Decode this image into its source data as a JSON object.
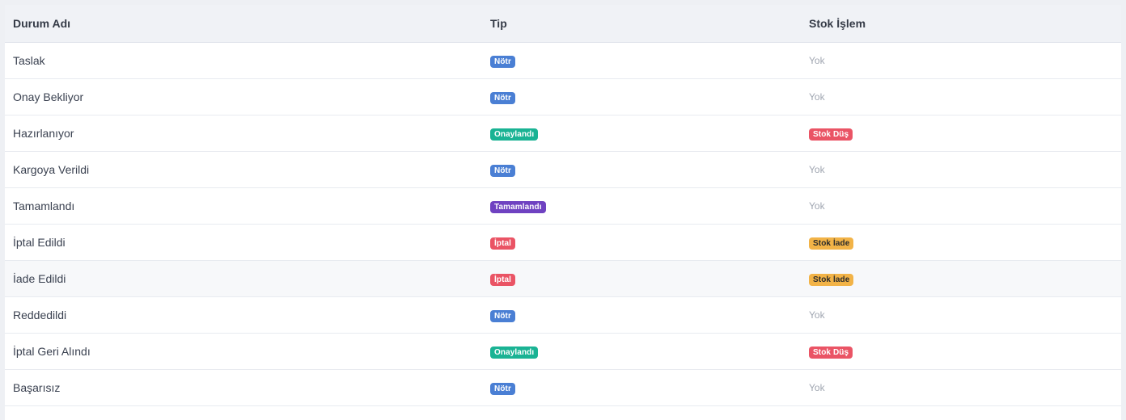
{
  "table": {
    "headers": [
      "Durum Adı",
      "Tip",
      "Stok İşlem"
    ],
    "rows": [
      {
        "name": "Taslak",
        "type": {
          "label": "Nötr",
          "color": "#4a7fd4"
        },
        "stock": {
          "label": "Yok",
          "badge": false
        }
      },
      {
        "name": "Onay Bekliyor",
        "type": {
          "label": "Nötr",
          "color": "#4a7fd4"
        },
        "stock": {
          "label": "Yok",
          "badge": false
        }
      },
      {
        "name": "Hazırlanıyor",
        "type": {
          "label": "Onaylandı",
          "color": "#1ab394"
        },
        "stock": {
          "label": "Stok Düş",
          "badge": true,
          "color": "#ea5465",
          "text_color": "#ffffff"
        }
      },
      {
        "name": "Kargoya Verildi",
        "type": {
          "label": "Nötr",
          "color": "#4a7fd4"
        },
        "stock": {
          "label": "Yok",
          "badge": false
        }
      },
      {
        "name": "Tamamlandı",
        "type": {
          "label": "Tamamlandı",
          "color": "#6f42c1"
        },
        "stock": {
          "label": "Yok",
          "badge": false
        }
      },
      {
        "name": "İptal Edildi",
        "type": {
          "label": "İptal",
          "color": "#ea5465"
        },
        "stock": {
          "label": "Stok İade",
          "badge": true,
          "color": "#f2b347",
          "text_color": "#2b2b2b"
        }
      },
      {
        "name": "İade Edildi",
        "type": {
          "label": "İptal",
          "color": "#ea5465"
        },
        "stock": {
          "label": "Stok İade",
          "badge": true,
          "color": "#f2b347",
          "text_color": "#2b2b2b"
        },
        "highlighted": true
      },
      {
        "name": "Reddedildi",
        "type": {
          "label": "Nötr",
          "color": "#4a7fd4"
        },
        "stock": {
          "label": "Yok",
          "badge": false
        }
      },
      {
        "name": "İptal Geri Alındı",
        "type": {
          "label": "Onaylandı",
          "color": "#1ab394"
        },
        "stock": {
          "label": "Stok Düş",
          "badge": true,
          "color": "#ea5465",
          "text_color": "#ffffff"
        }
      },
      {
        "name": "Başarısız",
        "type": {
          "label": "Nötr",
          "color": "#4a7fd4"
        },
        "stock": {
          "label": "Yok",
          "badge": false
        }
      }
    ]
  }
}
